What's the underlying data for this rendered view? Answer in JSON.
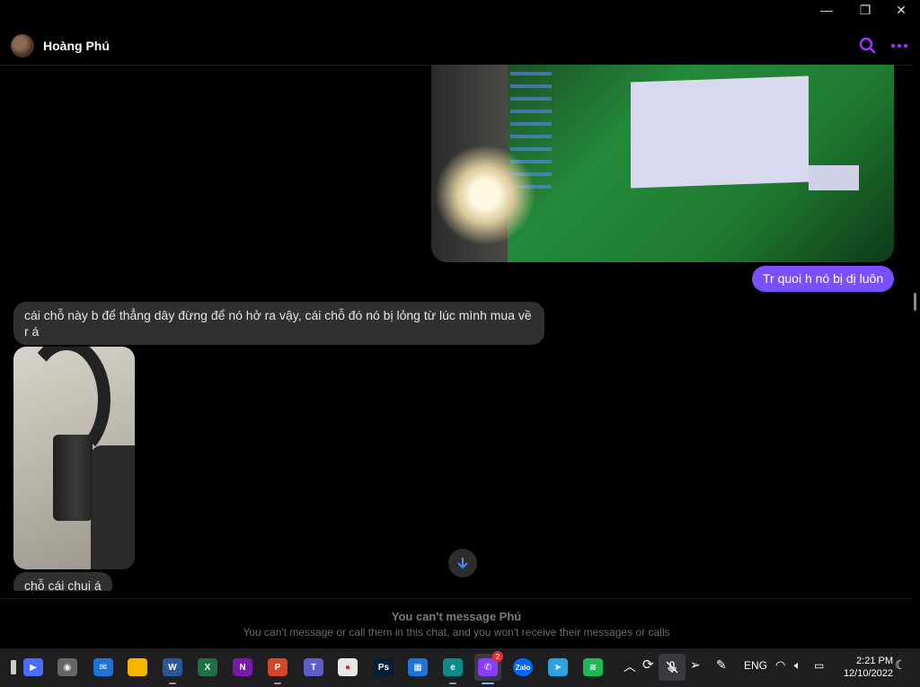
{
  "window": {
    "minimize": "—",
    "restore": "❐",
    "close": "✕"
  },
  "header": {
    "contact_name": "Hoàng Phú",
    "search_icon": "search-icon",
    "more_icon": "more-options-icon",
    "accent": "#a033ff"
  },
  "messages": {
    "outgoing_1": "Tr quoi h nó bị dị luôn",
    "incoming_1": "cái chỗ này b để thẳng dây đừng để nó hở ra vậy, cái chỗ đó nó bị lỏng từ lúc mình mua về r á",
    "incoming_2": "chỗ cái chui á",
    "outgoing_color": "#7b4fff",
    "incoming_color": "#303030"
  },
  "notice": {
    "title": "You can't message Phú",
    "subtitle": "You can't message or call them in this chat, and you won't receive their messages or calls"
  },
  "taskbar": {
    "apps": [
      {
        "name": "Zoom",
        "letter": "▶",
        "color": "#4a6cf7"
      },
      {
        "name": "Camera",
        "letter": "◉",
        "color": "#666"
      },
      {
        "name": "Mail",
        "letter": "✉",
        "color": "#1e73d8"
      },
      {
        "name": "File Explorer",
        "letter": "",
        "color": "#f4b400"
      },
      {
        "name": "Word",
        "letter": "W",
        "color": "#2b5797"
      },
      {
        "name": "Excel",
        "letter": "X",
        "color": "#1e7145"
      },
      {
        "name": "OneNote",
        "letter": "N",
        "color": "#7719aa"
      },
      {
        "name": "PowerPoint",
        "letter": "P",
        "color": "#d24726"
      },
      {
        "name": "Teams",
        "letter": "T",
        "color": "#5b5fc7"
      },
      {
        "name": "Chrome",
        "letter": "●",
        "color": "#e8e8e8"
      },
      {
        "name": "Photoshop",
        "letter": "Ps",
        "color": "#001e36"
      },
      {
        "name": "Calendar",
        "letter": "▦",
        "color": "#1e73d8"
      },
      {
        "name": "Edge",
        "letter": "e",
        "color": "#0c8a8a"
      },
      {
        "name": "Messenger",
        "letter": "✆",
        "color": "#8a3cff"
      },
      {
        "name": "Zalo",
        "letter": "Zalo",
        "color": "#0068ff"
      },
      {
        "name": "Telegram",
        "letter": "➤",
        "color": "#2aa3e0"
      },
      {
        "name": "Spotify",
        "letter": "≋",
        "color": "#1db954"
      }
    ],
    "messenger_badge": "2",
    "language": "ENG",
    "time": "2:21 PM",
    "date": "12/10/2022"
  }
}
